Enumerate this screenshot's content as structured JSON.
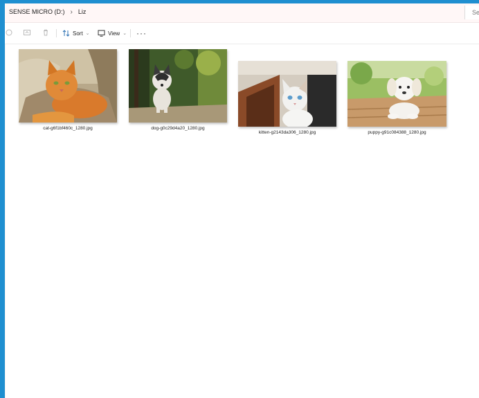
{
  "address": {
    "crumbs": [
      "SENSE MICRO (D:)",
      "Liz"
    ],
    "search_placeholder": "Se"
  },
  "toolbar": {
    "sort_label": "Sort",
    "view_label": "View",
    "more_label": "···"
  },
  "files": [
    {
      "name": "cat-g6f1bf460c_1280.jpg"
    },
    {
      "name": "dog-g0c29d4a20_1280.jpg"
    },
    {
      "name": "kitten-g2143da306_1280.jpg"
    },
    {
      "name": "puppy-g91c084388_1280.jpg"
    }
  ],
  "colors": {
    "desktop_bg": "#1f8fd0",
    "address_bg": "#fff7f7"
  }
}
